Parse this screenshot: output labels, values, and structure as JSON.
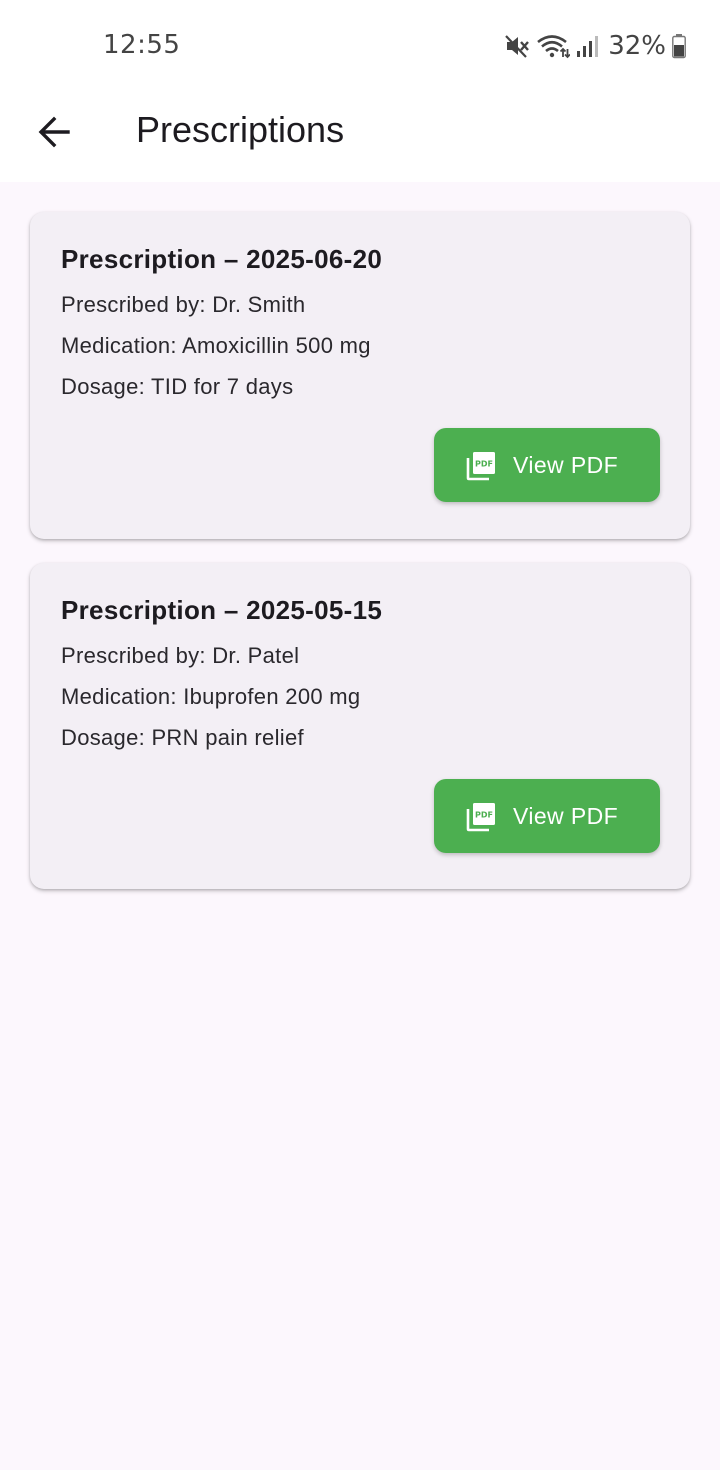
{
  "status_bar": {
    "time": "12:55",
    "battery": "32%",
    "icons": [
      "mute-icon",
      "wifi-icon",
      "signal-icon",
      "battery-icon"
    ]
  },
  "app_bar": {
    "title": "Prescriptions",
    "back_icon": "arrow-back-icon"
  },
  "prescriptions": [
    {
      "title": "Prescription – 2025-06-20",
      "prescribed_by": "Prescribed by: Dr. Smith",
      "medication": "Medication: Amoxicillin 500 mg",
      "dosage": "Dosage: TID for 7 days",
      "button_label": "View PDF"
    },
    {
      "title": "Prescription – 2025-05-15",
      "prescribed_by": "Prescribed by: Dr. Patel",
      "medication": "Medication: Ibuprofen 200 mg",
      "dosage": "Dosage: PRN pain relief",
      "button_label": "View PDF"
    }
  ],
  "colors": {
    "background": "#fcf7fd",
    "card": "#f3eff5",
    "button": "#4caf50",
    "button_text": "#ffffff",
    "title_text": "#1d1b20"
  }
}
